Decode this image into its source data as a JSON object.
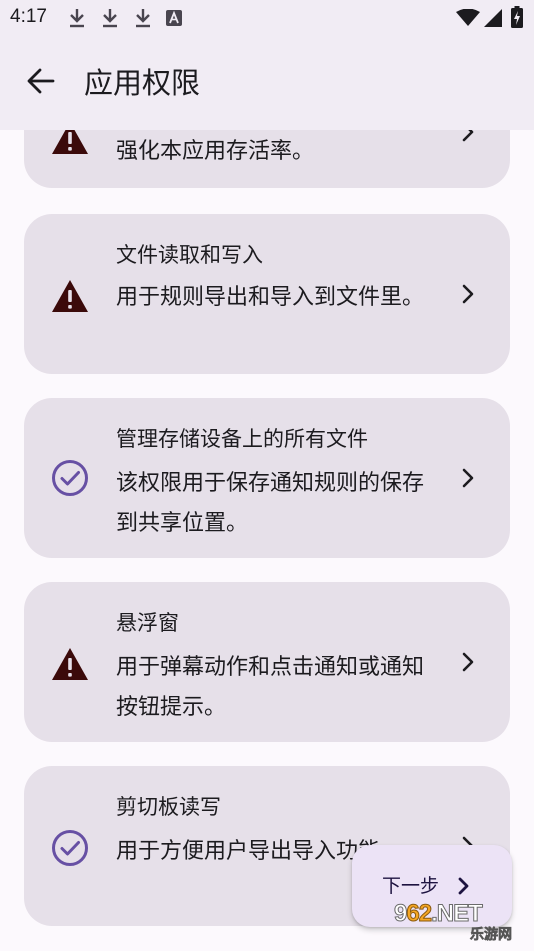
{
  "status_bar": {
    "time": "4:17",
    "icons": [
      "download-icon",
      "download-icon",
      "download-icon",
      "a-badge-icon",
      "wifi-icon",
      "signal-icon",
      "battery-charging-icon"
    ]
  },
  "header": {
    "back_icon": "arrow-back-icon",
    "title": "应用权限"
  },
  "permissions": [
    {
      "title": "",
      "description": "强化本应用存活率。",
      "status": "warning",
      "status_icon": "warning-icon"
    },
    {
      "title": "文件读取和写入",
      "description": "用于规则导出和导入到文件里。",
      "status": "warning",
      "status_icon": "warning-icon"
    },
    {
      "title": "管理存储设备上的所有文件",
      "description": "该权限用于保存通知规则的保存到共享位置。",
      "status": "granted",
      "status_icon": "check-circle-icon"
    },
    {
      "title": "悬浮窗",
      "description": "用于弹幕动作和点击通知或通知按钮提示。",
      "status": "warning",
      "status_icon": "warning-icon"
    },
    {
      "title": "剪切板读写",
      "description": "用于方便用户导出导入功能。",
      "status": "granted",
      "status_icon": "check-circle-icon"
    }
  ],
  "fab": {
    "label": "下一步",
    "icon": "chevron-right-icon"
  },
  "watermark": {
    "prefix": "9",
    "digits": "62",
    "suffix": ".NET",
    "subtitle": "乐游网"
  },
  "colors": {
    "background": "#fcf9fd",
    "app_bar": "#f1ecf4",
    "card": "#e6e0e9",
    "warning": "#3b0a0a",
    "granted": "#6750a4",
    "fab": "#ece3f6"
  }
}
